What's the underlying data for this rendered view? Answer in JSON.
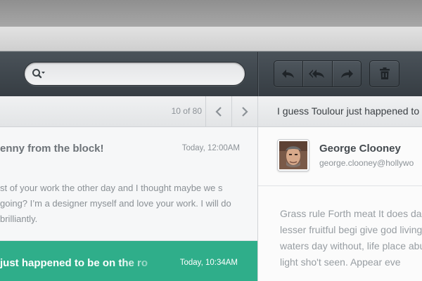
{
  "toolbar": {
    "search": {
      "value": "",
      "placeholder": ""
    },
    "actions": [
      "reply-icon",
      "reply-all-icon",
      "forward-icon",
      "trash-icon"
    ]
  },
  "list": {
    "pager": {
      "count": "10 of 80"
    },
    "messages": [
      {
        "subject": "enny from the block!",
        "time": "Today, 12:00AM",
        "preview": "st of your work the other day and I thought maybe we s going? I’m a designer myself and love your work. I will do brilliantly.",
        "selected": false
      },
      {
        "subject": "just happened to be on the ro",
        "time": "Today, 10:34AM",
        "selected": true
      }
    ]
  },
  "reader": {
    "subject": "I guess Toulour just happened to",
    "sender": {
      "name": "George Clooney",
      "email": "george.clooney@hollywo"
    },
    "body": "Grass rule Forth meat It does darkness i lesser fruitful begi give god living all waters day without, life place abundantl light sho't seen. Appear eve"
  },
  "colors": {
    "accent": "#2fae8a",
    "toolbar": "#3c4349",
    "list_bg": "#f6f7f8"
  }
}
